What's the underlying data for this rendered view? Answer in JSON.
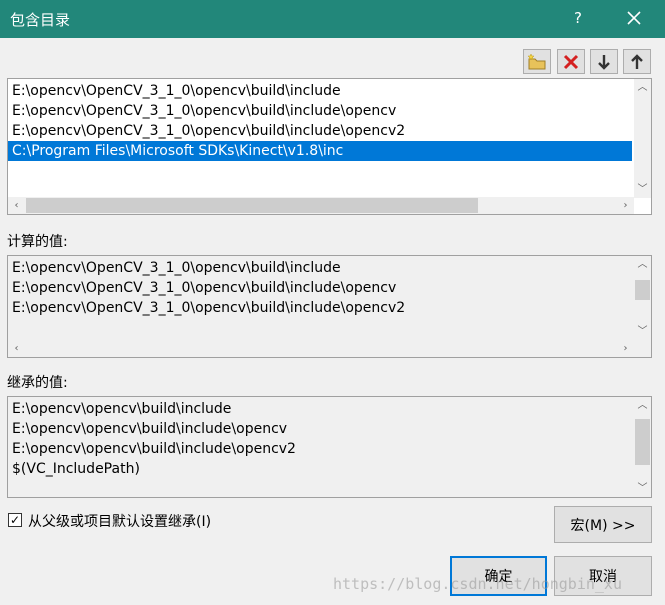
{
  "window": {
    "title": "包含目录",
    "help_label": "?"
  },
  "toolbar": {
    "buttons": [
      {
        "icon": "new-folder-icon"
      },
      {
        "icon": "delete-icon"
      },
      {
        "icon": "move-down-icon"
      },
      {
        "icon": "move-up-icon"
      }
    ]
  },
  "directories": {
    "items": [
      "E:\\opencv\\OpenCV_3_1_0\\opencv\\build\\include",
      "E:\\opencv\\OpenCV_3_1_0\\opencv\\build\\include\\opencv",
      "E:\\opencv\\OpenCV_3_1_0\\opencv\\build\\include\\opencv2",
      "C:\\Program Files\\Microsoft SDKs\\Kinect\\v1.8\\inc"
    ],
    "selected_index": 3
  },
  "computed": {
    "label": "计算的值:",
    "items": [
      "E:\\opencv\\OpenCV_3_1_0\\opencv\\build\\include",
      "E:\\opencv\\OpenCV_3_1_0\\opencv\\build\\include\\opencv",
      "E:\\opencv\\OpenCV_3_1_0\\opencv\\build\\include\\opencv2"
    ]
  },
  "inherited": {
    "label": "继承的值:",
    "items": [
      "E:\\opencv\\opencv\\build\\include",
      "E:\\opencv\\opencv\\build\\include\\opencv",
      "E:\\opencv\\opencv\\build\\include\\opencv2",
      "$(VC_IncludePath)"
    ]
  },
  "inherit_checkbox": {
    "label": "从父级或项目默认设置继承(I)",
    "checked": true,
    "check_glyph": "✓"
  },
  "buttons": {
    "macro": "宏(M) >>",
    "ok": "确定",
    "cancel": "取消"
  },
  "watermark": "https://blog.csdn.net/hongbin_xu",
  "colors": {
    "titlebar": "#22877a",
    "selection": "#0078d7"
  }
}
